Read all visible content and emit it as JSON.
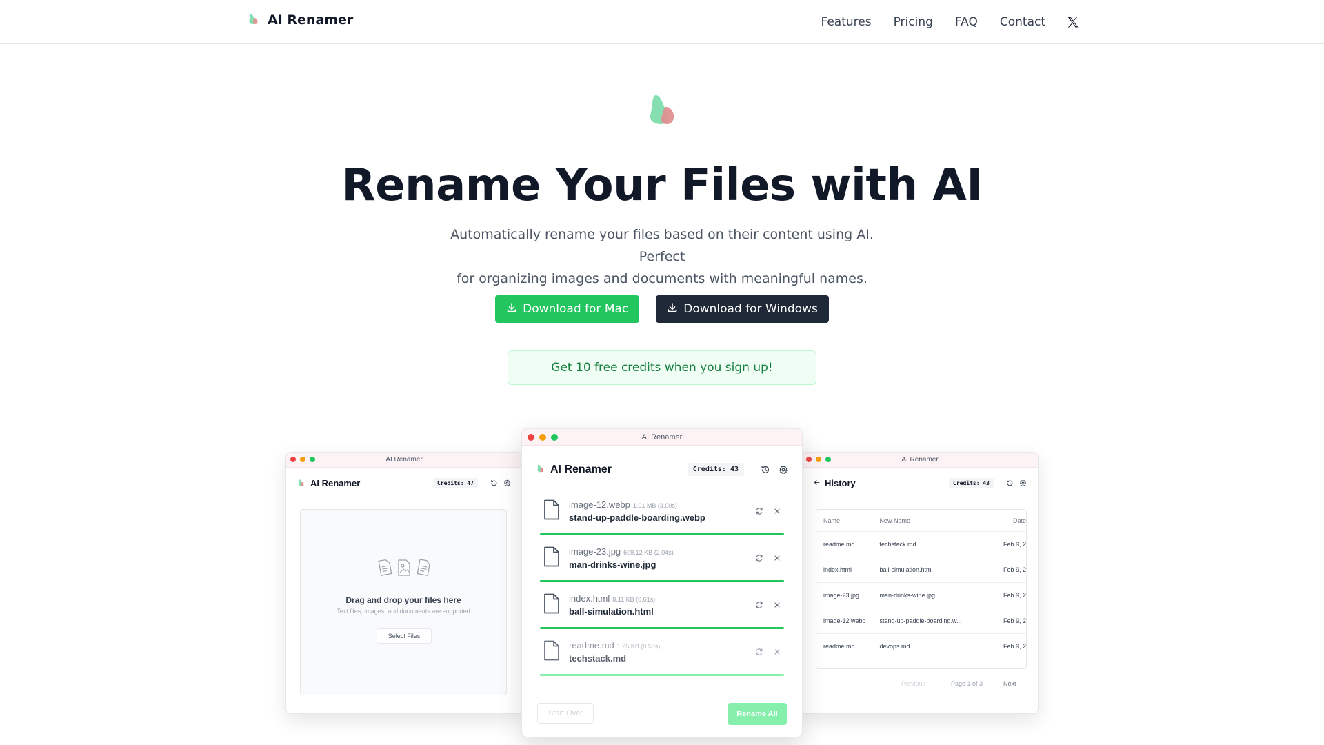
{
  "header": {
    "brand": "AI Renamer",
    "nav": [
      "Features",
      "Pricing",
      "FAQ",
      "Contact"
    ]
  },
  "hero": {
    "title": "Rename Your Files with AI",
    "subtitle_line1": "Automatically rename your files based on their content using AI. Perfect",
    "subtitle_line2": "for organizing images and documents with meaningful names.",
    "download_mac": "Download for Mac",
    "download_windows": "Download for Windows",
    "credits_banner": "Get 10 free credits when you sign up!"
  },
  "colors": {
    "accent": "#22c55e",
    "dark_button": "#1f2937",
    "logo_green": "#86dfb0",
    "logo_red": "#e08e8e"
  },
  "icons": {
    "logo": "logo-icon",
    "x": "x-twitter-icon",
    "download": "download-icon",
    "history": "history-icon",
    "settings": "settings-icon",
    "refresh": "refresh-icon",
    "close": "close-icon",
    "file": "file-icon",
    "back": "arrow-left-icon"
  },
  "window_left": {
    "title": "AI Renamer",
    "app_title": "AI Renamer",
    "credits": "Credits: 47",
    "drop_title": "Drag and drop your files here",
    "drop_sub": "Text files, images, and documents are supported",
    "select_button": "Select Files"
  },
  "window_center": {
    "title": "AI Renamer",
    "app_title": "AI Renamer",
    "credits": "Credits: 43",
    "files": [
      {
        "old": "image-12.webp",
        "meta": "1.01 MB (3.00s)",
        "new": "stand-up-paddle-boarding.webp",
        "progress": 1.0
      },
      {
        "old": "image-23.jpg",
        "meta": "609.12 KB (2.04s)",
        "new": "man-drinks-wine.jpg",
        "progress": 1.0
      },
      {
        "old": "index.html",
        "meta": "8.11 KB (0.61s)",
        "new": "ball-simulation.html",
        "progress": 1.0
      },
      {
        "old": "readme.md",
        "meta": "1.25 KB (0.50s)",
        "new": "techstack.md",
        "progress": 1.0
      }
    ],
    "start_over": "Start Over",
    "rename_all": "Rename All"
  },
  "window_right": {
    "title": "AI Renamer",
    "app_title": "History",
    "credits": "Credits: 43",
    "columns": [
      "Name",
      "New Name",
      "Date"
    ],
    "rows": [
      {
        "name": "readme.md",
        "new_name": "techstack.md",
        "date": "Feb 9, 2"
      },
      {
        "name": "index.html",
        "new_name": "ball-simulation.html",
        "date": "Feb 9, 2"
      },
      {
        "name": "image-23.jpg",
        "new_name": "man-drinks-wine.jpg",
        "date": "Feb 9, 2"
      },
      {
        "name": "image-12.webp",
        "new_name": "stand-up-paddle-boarding.w...",
        "date": "Feb 9, 2"
      },
      {
        "name": "readme.md",
        "new_name": "devops.md",
        "date": "Feb 9, 2"
      }
    ],
    "pager_previous": "Previous",
    "pager_info": "Page 1 of 3",
    "pager_next": "Next"
  }
}
